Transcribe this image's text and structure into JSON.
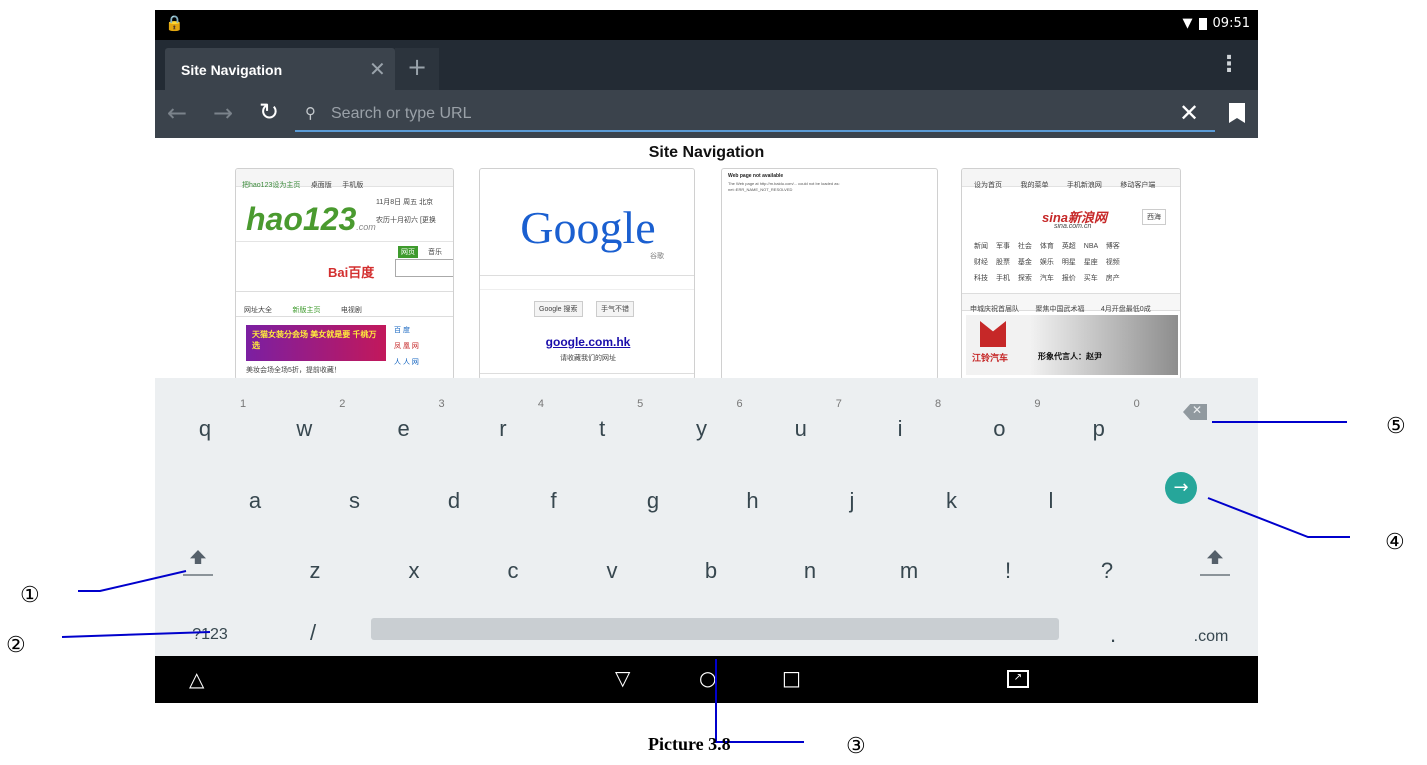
{
  "status_bar": {
    "time": "09:51"
  },
  "browser": {
    "tab_title": "Site Navigation",
    "url_placeholder": "Search or type URL"
  },
  "content": {
    "page_title": "Site Navigation",
    "thumbnails": {
      "hao123": {
        "top_links": [
          "把hao123设为主页",
          "桌面版",
          "手机版"
        ],
        "logo": "hao123",
        "logo_suffix": ".com",
        "date": "11月8日 周五",
        "city": "北京",
        "lunar": "农历十月初六",
        "weather": "[更换",
        "search_tabs": [
          "网页",
          "音乐"
        ],
        "baidu": "Bai百度",
        "nav": [
          "网址大全",
          "新版主页",
          "电视剧"
        ],
        "banner": "天猫女装分会场 美女就是要 千桃万选",
        "banner_caption": "美妆会场全场5折，提前收藏！",
        "side_links": [
          "百 度",
          "凤 凰 网",
          "人 人 网"
        ]
      },
      "google": {
        "logo": "Google",
        "logo_sub": "谷歌",
        "btn_search": "Google 搜索",
        "btn_lucky": "手气不错",
        "link": "google.com.hk",
        "link_caption": "请收藏我们的网址"
      },
      "blank": {
        "title": "Web page not available",
        "line1": "The Web page at http://m.baidu.com/... could not be loaded as:",
        "line2": "net::ERR_NAME_NOT_RESOLVED"
      },
      "sina": {
        "top_links": [
          "设为首页",
          "我的菜单",
          "手机新浪网",
          "移动客户端"
        ],
        "logo": "sina新浪网",
        "logo_sub": "sina.com.cn",
        "location": "西海",
        "rows": [
          [
            "新闻",
            "军事",
            "社会",
            "体育",
            "英超",
            "NBA",
            "博客"
          ],
          [
            "财经",
            "股票",
            "基金",
            "娱乐",
            "明星",
            "星座",
            "视频"
          ],
          [
            "科技",
            "手机",
            "探索",
            "汽车",
            "报价",
            "买车",
            "房产"
          ]
        ],
        "ticker": [
          "申城庆祝首届队",
          "聚焦中国武术福",
          "4月开盘最低0成"
        ],
        "ad_brand": "江铃汽车",
        "ad_text": "形象代言人：赵尹"
      }
    }
  },
  "keyboard": {
    "row1": [
      "q",
      "w",
      "e",
      "r",
      "t",
      "y",
      "u",
      "i",
      "o",
      "p"
    ],
    "row1_hints": [
      "1",
      "2",
      "3",
      "4",
      "5",
      "6",
      "7",
      "8",
      "9",
      "0"
    ],
    "row2": [
      "a",
      "s",
      "d",
      "f",
      "g",
      "h",
      "j",
      "k",
      "l"
    ],
    "row3": [
      "z",
      "x",
      "c",
      "v",
      "b",
      "n",
      "m",
      "!",
      "?"
    ],
    "symbols_key": "?123",
    "slash_key": "/",
    "period_key": ".",
    "dotcom_key": ".com"
  },
  "annotations": {
    "shift": "①",
    "symbols": "②",
    "space": "③",
    "enter": "④",
    "delete": "⑤"
  },
  "caption": "Picture 3.8"
}
